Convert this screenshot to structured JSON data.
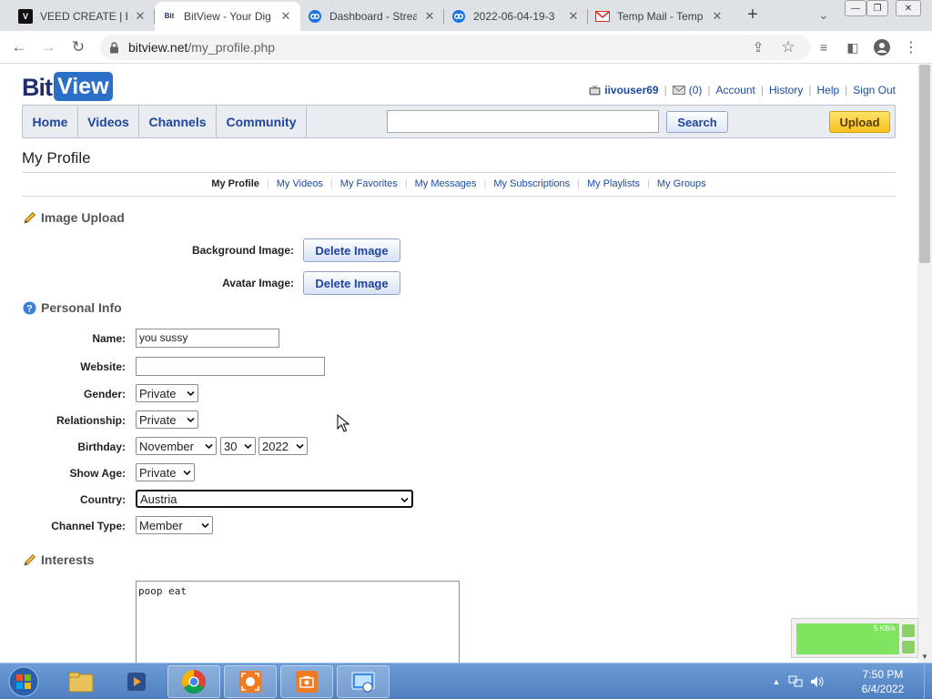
{
  "browser": {
    "tabs": [
      {
        "title": "VEED CREATE | Ed",
        "favicon": "V",
        "favicon_color": "#111111",
        "active": false
      },
      {
        "title": "BitView - Your Dig",
        "favicon": "Bit",
        "favicon_color": "#1f2f6e",
        "active": true
      },
      {
        "title": "Dashboard - Strea",
        "favicon": "cc",
        "favicon_color": "#1a73e8",
        "active": false
      },
      {
        "title": "2022-06-04-19-3",
        "favicon": "cc",
        "favicon_color": "#1a73e8",
        "active": false
      },
      {
        "title": "Temp Mail - Temp",
        "favicon": "M",
        "favicon_color": "#d93025",
        "active": false
      }
    ],
    "url_host": "bitview.net",
    "url_path": "/my_profile.php"
  },
  "site": {
    "logo_bit": "Bit",
    "logo_view": "View",
    "username": "iivouser69",
    "inbox_count": "(0)",
    "links": [
      "Account",
      "History",
      "Help",
      "Sign Out"
    ],
    "nav": [
      "Home",
      "Videos",
      "Channels",
      "Community"
    ],
    "search_label": "Search",
    "upload_label": "Upload"
  },
  "profile": {
    "title": "My Profile",
    "subnav": [
      "My Profile",
      "My Videos",
      "My Favorites",
      "My Messages",
      "My Subscriptions",
      "My Playlists",
      "My Groups"
    ],
    "image_upload": {
      "heading": "Image Upload",
      "background_label": "Background Image:",
      "avatar_label": "Avatar Image:",
      "delete_label": "Delete Image"
    },
    "personal": {
      "heading": "Personal Info",
      "name_label": "Name:",
      "name_value": "you sussy",
      "website_label": "Website:",
      "website_value": "",
      "gender_label": "Gender:",
      "gender_value": "Private",
      "relationship_label": "Relationship:",
      "relationship_value": "Private",
      "birthday_label": "Birthday:",
      "birthday_month": "November",
      "birthday_day": "30",
      "birthday_year": "2022",
      "show_age_label": "Show Age:",
      "show_age_value": "Private",
      "country_label": "Country:",
      "country_value": "Austria",
      "channel_type_label": "Channel Type:",
      "channel_type_value": "Member"
    },
    "interests": {
      "heading": "Interests",
      "value": "poop eat"
    }
  },
  "widget": {
    "speed": "5 KB/s"
  },
  "taskbar": {
    "time": "7:50 PM",
    "date": "6/4/2022"
  }
}
